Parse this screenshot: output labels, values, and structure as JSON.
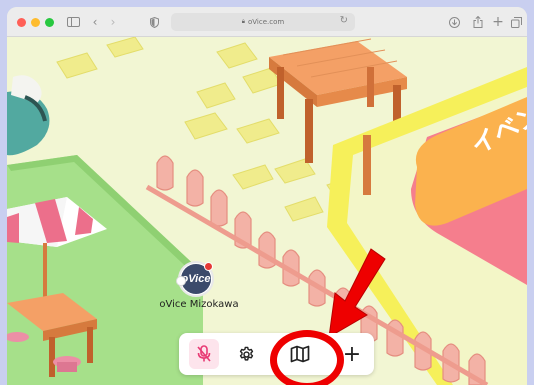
{
  "browser": {
    "url": "oVice.com",
    "lock_icon": "lock-icon",
    "reload_icon": "reload-icon"
  },
  "scene": {
    "sign_text": "イベン",
    "avatar": {
      "logo_text": "oVice",
      "name": "oVice Mizokawa"
    }
  },
  "dock": {
    "buttons": [
      {
        "name": "mic-muted-button",
        "icon": "mic-off-icon"
      },
      {
        "name": "settings-button",
        "icon": "gear-icon"
      },
      {
        "name": "map-button",
        "icon": "map-icon"
      },
      {
        "name": "add-button",
        "icon": "plus-icon"
      }
    ],
    "plus_glyph": "+"
  },
  "colors": {
    "highlight": "#ee0000",
    "mic_bg": "#fde4ec",
    "mic_icon": "#e83a74",
    "floor": "#f2f6d3",
    "grass": "#a6e08a",
    "tile": "#f0ec8c",
    "fence": "#f3b2a6",
    "sign_orange": "#fbb24e",
    "sign_pink": "#f57e8d"
  }
}
